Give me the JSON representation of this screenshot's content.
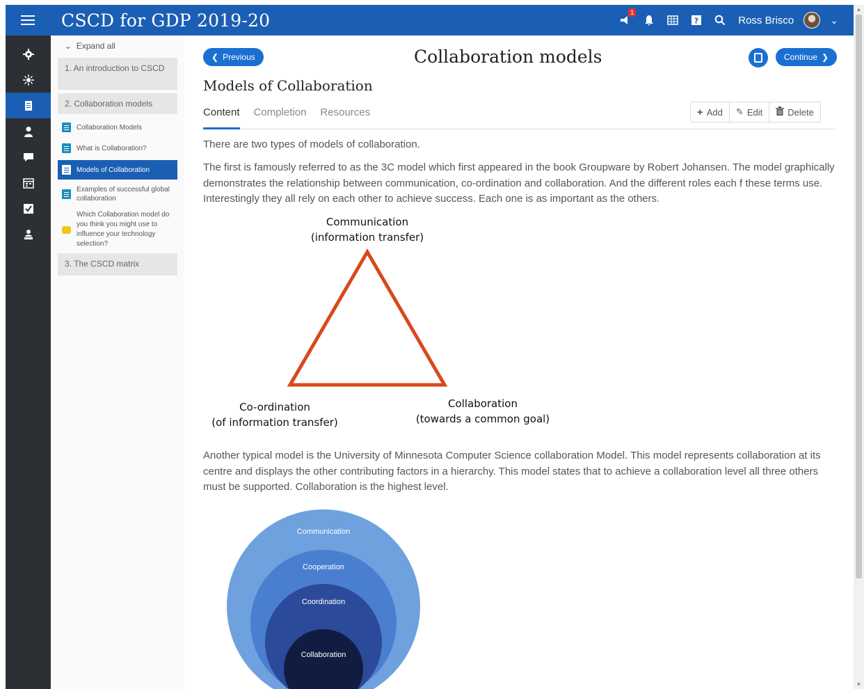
{
  "app": {
    "title": "CSCD for GDP 2019-20",
    "notification_count": "1",
    "user_name": "Ross Brisco"
  },
  "icons": {
    "rail": [
      "gear-icon",
      "sun-icon",
      "course-icon",
      "person-icon",
      "chat-icon",
      "calendar-icon",
      "checkbox-icon",
      "group-icon"
    ],
    "topbar": [
      "alert-icon",
      "bell-icon",
      "grid-icon",
      "help-icon",
      "search-icon",
      "chevron-down-icon"
    ]
  },
  "nav": {
    "expand_all": "Expand all",
    "sections": [
      {
        "label": "1. An introduction to CSCD"
      },
      {
        "label": "2. Collaboration models"
      },
      {
        "label": "3. The CSCD matrix"
      }
    ],
    "items": [
      {
        "label": "Collaboration Models"
      },
      {
        "label": "What is Collaboration?"
      },
      {
        "label": "Models of Collaboration"
      },
      {
        "label": "Examples of successful global collaboration"
      },
      {
        "label": "Which Collaboration model do you think you might use to influence your technology selection?"
      }
    ]
  },
  "page": {
    "previous_label": "Previous",
    "continue_label": "Continue",
    "heading": "Collaboration models",
    "sub_heading": "Models of Collaboration",
    "tabs": [
      "Content",
      "Completion",
      "Resources"
    ],
    "actions": {
      "add": "Add",
      "edit": "Edit",
      "delete": "Delete"
    }
  },
  "content": {
    "intro": "There are two types of models of collaboration.",
    "para1": "The first is famously referred to as the 3C model which first appeared in the book Groupware by Robert Johansen. The model graphically demonstrates the relationship between communication, co-ordination and collaboration. And the different roles each f these terms use. Interestingly they all rely on each other to achieve success. Each one is as important as the others.",
    "triangle": {
      "top": "Communication",
      "top_sub": "(information transfer)",
      "left": "Co-ordination",
      "left_sub": "(of information transfer)",
      "right": "Collaboration",
      "right_sub": "(towards a common goal)"
    },
    "para2": "Another typical model is the University of Minnesota Computer Science collaboration Model. This model represents collaboration at its centre and displays the other contributing factors in a hierarchy. This model states that to achieve a collaboration level all three others must be supported. Collaboration is the highest level.",
    "circles": [
      "Communication",
      "Cooperation",
      "Coordination",
      "Collaboration"
    ],
    "colors": {
      "triangle": "#d9481c",
      "circles": [
        "#6fa1de",
        "#4a7fd0",
        "#2b4a9a",
        "#101d40"
      ]
    }
  }
}
